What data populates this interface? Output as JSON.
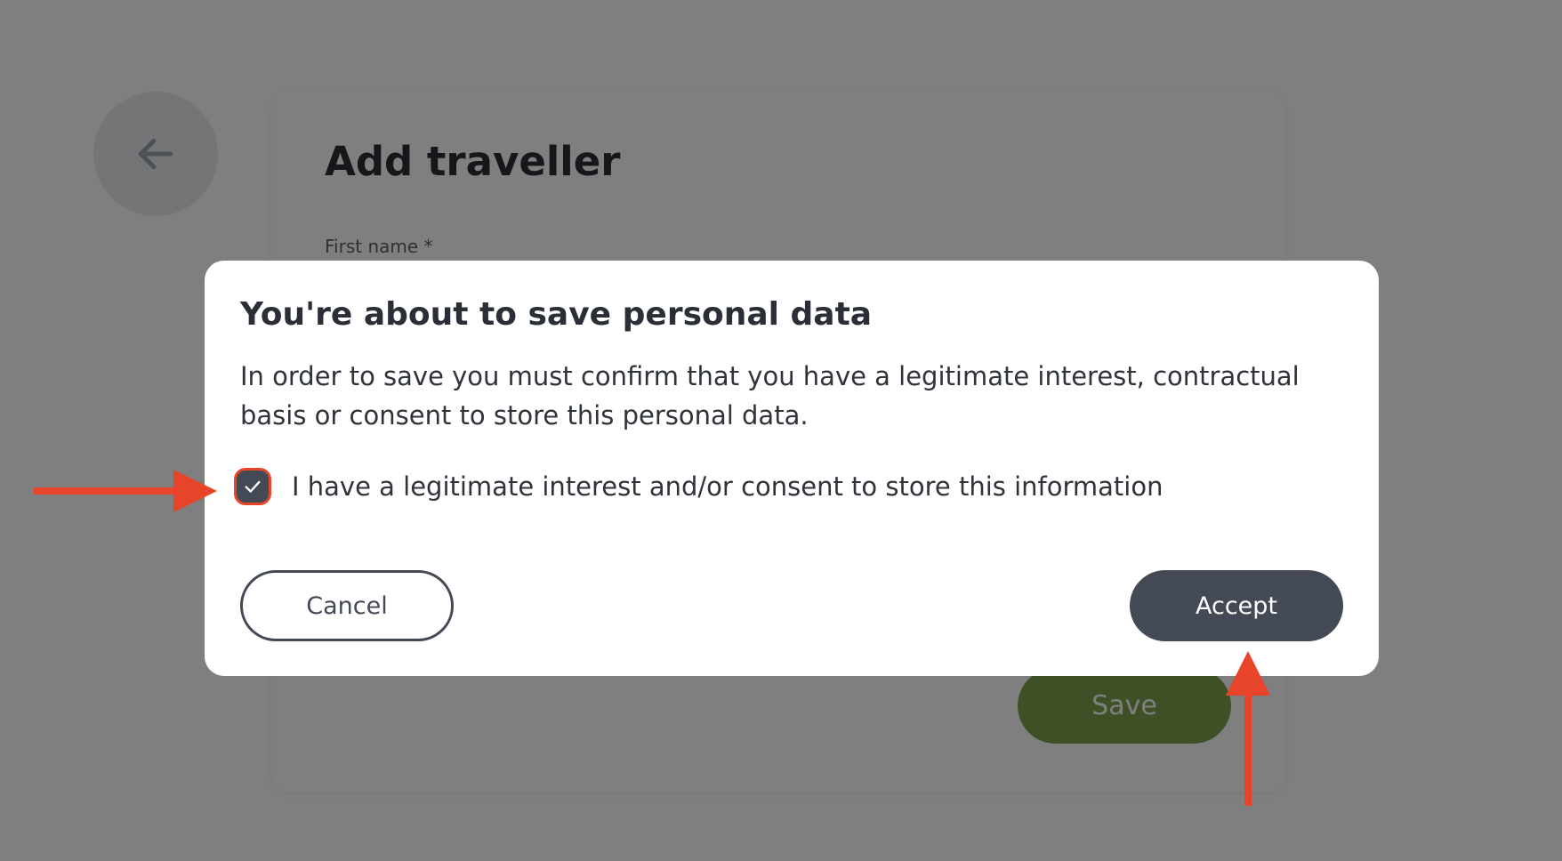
{
  "page": {
    "title": "Add traveller",
    "first_name_label": "First name *",
    "save_label": "Save",
    "back_icon": "arrow-left-icon"
  },
  "modal": {
    "title": "You're about to save personal data",
    "body": "In order to save you must confirm that you have a legitimate interest, contractual basis or consent to store this personal data.",
    "consent_label": "I have a legitimate interest and/or consent to store this information",
    "consent_checked": true,
    "checkbox_icon": "checkmark-icon",
    "cancel_label": "Cancel",
    "accept_label": "Accept"
  },
  "annotations": {
    "color": "#e8442a",
    "arrows": [
      "arrow-right-icon",
      "arrow-up-icon"
    ]
  },
  "colors": {
    "primary_dark": "#444a55",
    "save_green": "#7ea14f",
    "overlay": "rgba(0,0,0,0.5)"
  }
}
